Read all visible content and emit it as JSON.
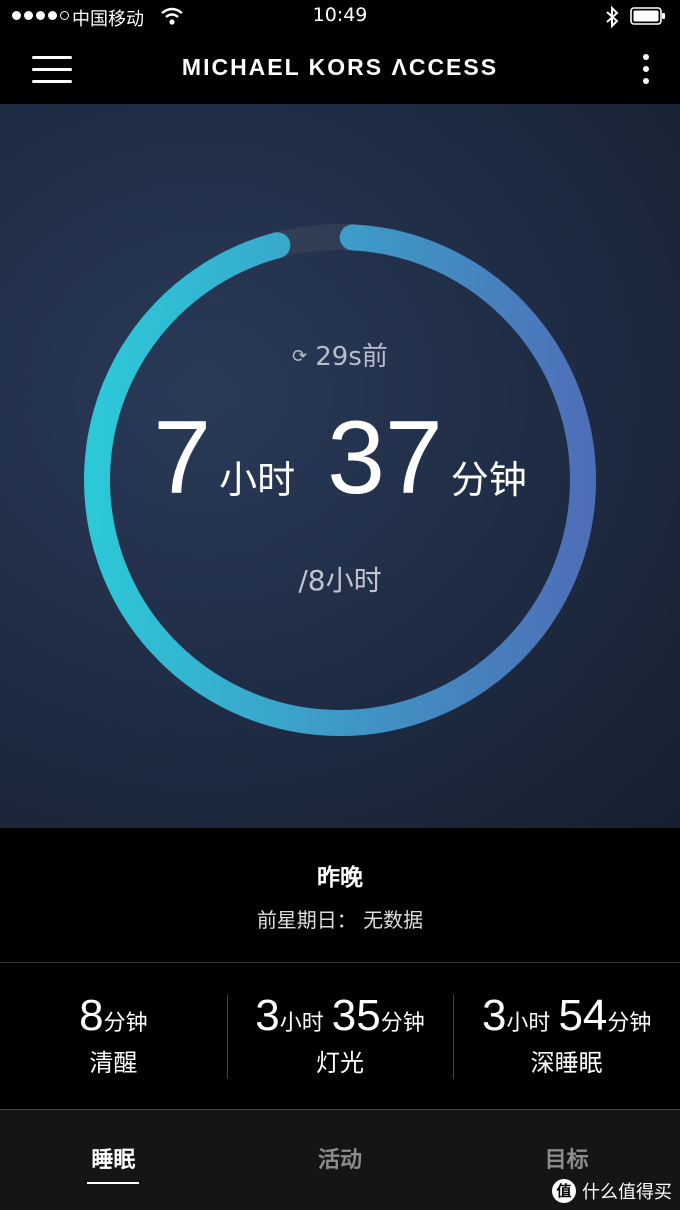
{
  "status_bar": {
    "carrier": "中国移动",
    "time": "10:49"
  },
  "header": {
    "brand": "MICHAEL KORS ΛCCESS"
  },
  "sleep": {
    "sync_text": "29s前",
    "hours": "7",
    "hours_unit": "小时",
    "minutes": "37",
    "minutes_unit": "分钟",
    "goal": "/8小时",
    "progress_fraction": 0.95,
    "ring_colors": {
      "start": "#2cc8d8",
      "end": "#4e6fb8",
      "track": "#3a465a"
    }
  },
  "summary": {
    "title": "昨晚",
    "subtitle": "前星期日： 无数据"
  },
  "stats": [
    {
      "label": "清醒",
      "parts": [
        {
          "num": "8",
          "unit": "分钟"
        }
      ]
    },
    {
      "label": "灯光",
      "parts": [
        {
          "num": "3",
          "unit": "小时"
        },
        {
          "num": "35",
          "unit": "分钟"
        }
      ]
    },
    {
      "label": "深睡眠",
      "parts": [
        {
          "num": "3",
          "unit": "小时"
        },
        {
          "num": "54",
          "unit": "分钟"
        }
      ]
    }
  ],
  "tabs": [
    {
      "label": "睡眠",
      "active": true
    },
    {
      "label": "活动",
      "active": false
    },
    {
      "label": "目标",
      "active": false
    }
  ],
  "watermark": {
    "logo": "值",
    "text": "什么值得买"
  }
}
